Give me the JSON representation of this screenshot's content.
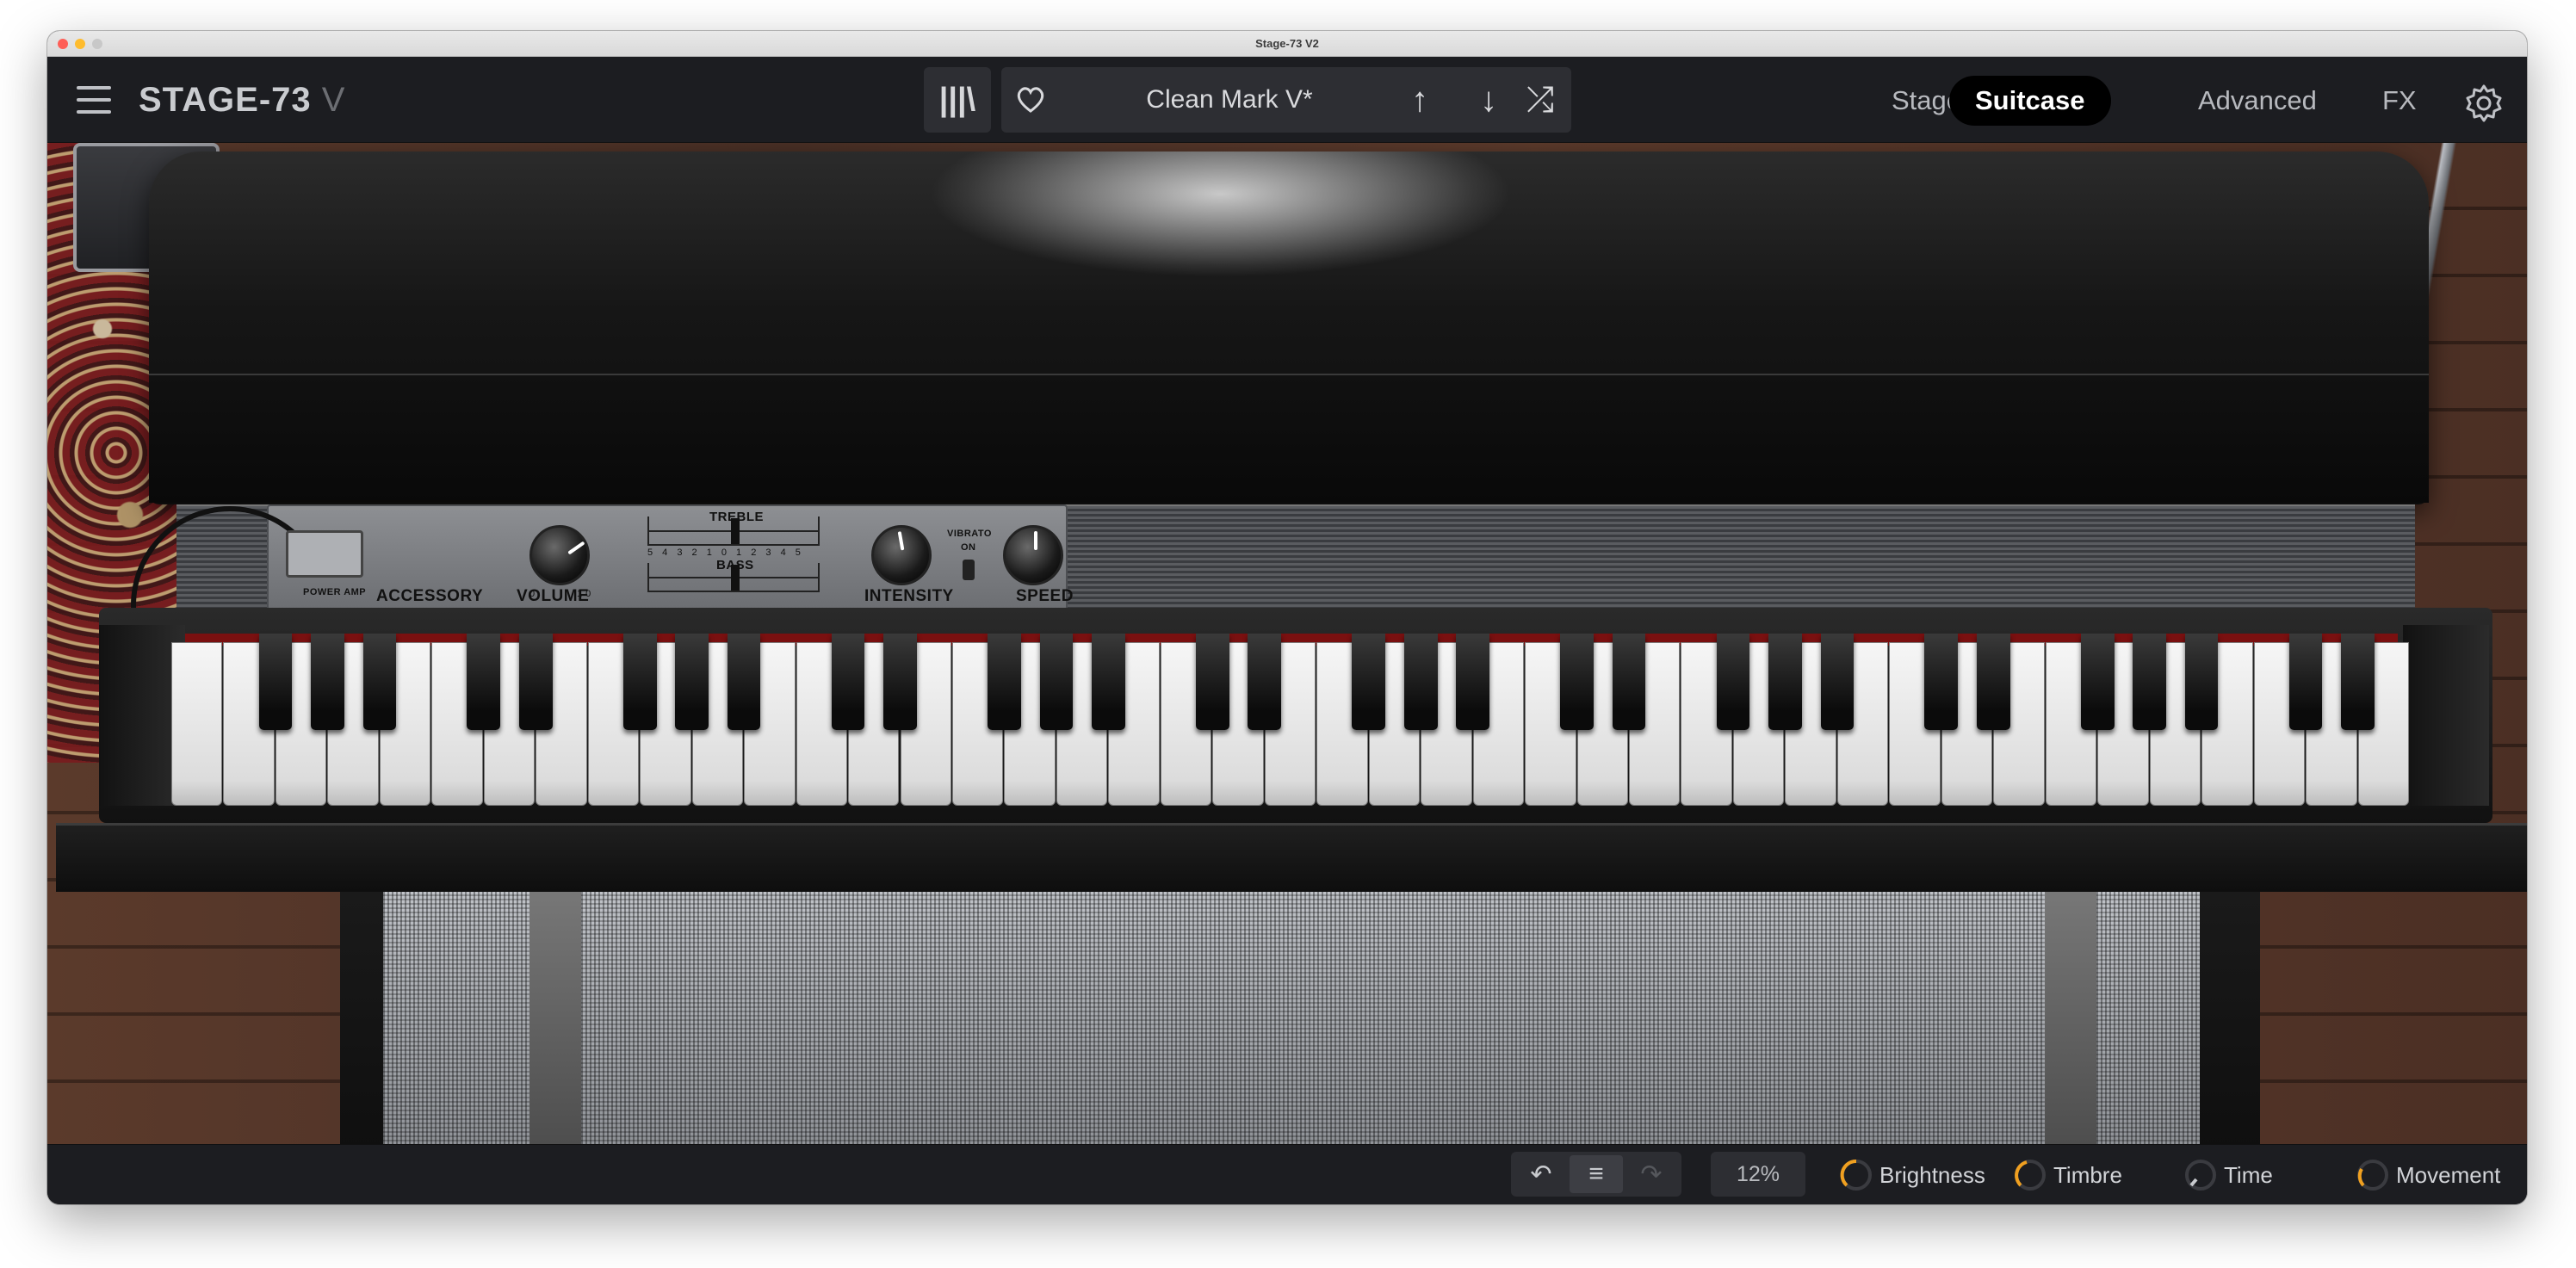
{
  "window": {
    "title": "Stage-73 V2"
  },
  "header": {
    "logo_main": "STAGE-73",
    "logo_suffix": "V",
    "library_icon_glyph": "|||\\",
    "preset_name": "Clean Mark V*",
    "prev_glyph": "↑",
    "next_glyph": "↓",
    "random_glyph": "⤮",
    "tabs": [
      {
        "label": "Stage",
        "active": false
      },
      {
        "label": "Suitcase",
        "active": true
      },
      {
        "label": "Advanced",
        "active": false
      },
      {
        "label": "FX",
        "active": false
      }
    ]
  },
  "panel": {
    "accessory": "ACCESSORY",
    "volume": "VOLUME",
    "treble": "TREBLE",
    "bass": "BASS",
    "intensity": "INTENSITY",
    "vibrato": "VIBRATO",
    "vibrato_on": "ON",
    "speed": "SPEED",
    "power_amp": "POWER AMP",
    "tick_scale": "5 4 3 2 1 0 1 2 3 4 5",
    "knob_scale_low": "0",
    "knob_scale_high": "10"
  },
  "bottom": {
    "undo_glyph": "↶",
    "menu_glyph": "≡",
    "redo_glyph": "↷",
    "cpu": "12%",
    "macros": [
      {
        "label": "Brightness",
        "color": "#f0a020"
      },
      {
        "label": "Timbre",
        "color": "#f0a020"
      },
      {
        "label": "Time",
        "color": "#c9cbcf"
      },
      {
        "label": "Movement",
        "color": "#f0a020"
      }
    ]
  },
  "colors": {
    "accent": "#f0a020",
    "active_tab_bg": "#000000",
    "toolbar_bg": "#1c1d21"
  }
}
